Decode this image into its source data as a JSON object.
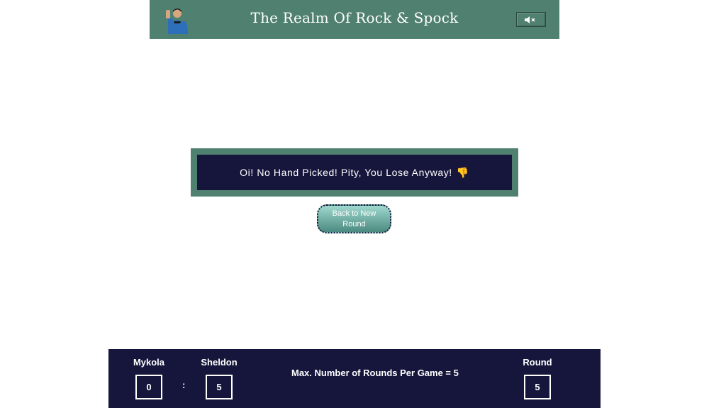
{
  "header": {
    "title": "The Realm Of Rock & Spock",
    "avatar_icon": "spock-avatar-icon",
    "mute_icon": "speaker-mute-icon",
    "mute_glyph": "🔈×"
  },
  "message": {
    "text": "Oi! No Hand Picked! Pity, You Lose Anyway!",
    "emoji": "👎"
  },
  "back_button": {
    "label": "Back to New Round"
  },
  "scoreboard": {
    "player1_name": "Mykola",
    "player1_score": "0",
    "separator": ":",
    "player2_name": "Sheldon",
    "player2_score": "5",
    "max_rounds_text": "Max. Number of Rounds Per Game = 5",
    "round_label": "Round",
    "round_value": "5"
  },
  "colors": {
    "header_bg": "#508070",
    "dark_navy": "#16163c",
    "button_gradient_top": "#9fd8ce",
    "button_gradient_bottom": "#4b8a80"
  }
}
